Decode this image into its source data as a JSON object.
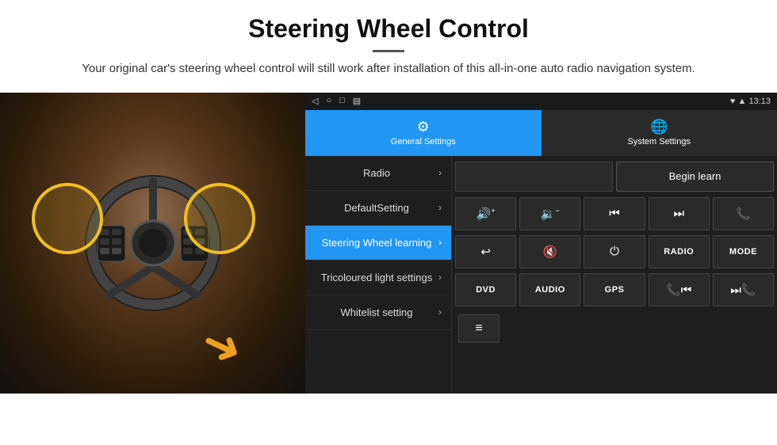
{
  "header": {
    "title": "Steering Wheel Control",
    "subtitle": "Your original car's steering wheel control will still work after installation of this all-in-one auto radio navigation system."
  },
  "tablet": {
    "status_bar": {
      "time": "13:13",
      "nav_icons": [
        "◁",
        "○",
        "□",
        "▤"
      ]
    },
    "tabs": [
      {
        "label": "General Settings",
        "icon": "⚙",
        "active": true
      },
      {
        "label": "System Settings",
        "icon": "🌐",
        "active": false
      }
    ],
    "menu_items": [
      {
        "label": "Radio",
        "active": false
      },
      {
        "label": "DefaultSetting",
        "active": false
      },
      {
        "label": "Steering Wheel learning",
        "active": true
      },
      {
        "label": "Tricoloured light settings",
        "active": false
      },
      {
        "label": "Whitelist setting",
        "active": false
      }
    ],
    "controls": {
      "begin_learn_label": "Begin learn",
      "buttons_row1": [
        "🔊+",
        "🔉−",
        "⏮",
        "⏭",
        "📞"
      ],
      "buttons_row1_icons": [
        "vol-up",
        "vol-down",
        "prev-track",
        "next-track",
        "phone"
      ],
      "buttons_row2": [
        "↩",
        "🔇",
        "⏻",
        "RADIO",
        "MODE"
      ],
      "buttons_row3": [
        "DVD",
        "AUDIO",
        "GPS",
        "📞⏮",
        "⏭📞"
      ],
      "whitelist_icon": "≡"
    }
  }
}
